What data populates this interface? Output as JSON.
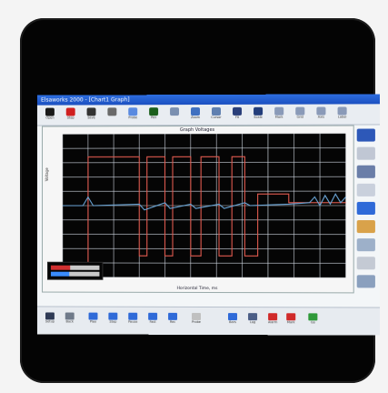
{
  "window": {
    "title": "Elsaworks 2000 - [Chart1 Graph]"
  },
  "toolbar": {
    "buttons": [
      {
        "label": "Open",
        "color": "#1a1a1a"
      },
      {
        "label": "Stop",
        "color": "#d02020"
      },
      {
        "label": "Save",
        "color": "#333333"
      },
      {
        "label": "",
        "color": "#6a6a6a"
      },
      {
        "label": "Probe",
        "color": "#5a8ae0"
      },
      {
        "label": "Pen",
        "color": "#1b5f1b"
      },
      {
        "label": "",
        "color": "#7a8fb0"
      },
      {
        "label": "Zoom",
        "color": "#4070c0"
      },
      {
        "label": "Cursor",
        "color": "#6080b0"
      },
      {
        "label": "Fit",
        "color": "#2a3f7a"
      },
      {
        "label": "Scale",
        "color": "#233d7a"
      },
      {
        "label": "Mark",
        "color": "#8a9ab8"
      },
      {
        "label": "Grid",
        "color": "#8a9ab8"
      },
      {
        "label": "Axis",
        "color": "#8a9ab8"
      },
      {
        "label": "Label",
        "color": "#8a9ab8"
      }
    ]
  },
  "chart_data": {
    "type": "line",
    "title": "Graph Voltages",
    "xlabel": "Horizontal Time, ms",
    "ylabel": "Voltage",
    "grid": true,
    "background": "#050505",
    "xlim": [
      0,
      11
    ],
    "ylim": [
      -5,
      5
    ],
    "series": [
      {
        "color": "#e05a4f",
        "x": [
          0,
          1.0,
          1.0,
          3.0,
          3.0,
          3.3,
          3.3,
          4.0,
          4.0,
          4.3,
          4.3,
          5.0,
          5.0,
          5.4,
          5.4,
          6.1,
          6.1,
          6.6,
          6.6,
          7.1,
          7.1,
          7.6,
          7.6,
          8.8,
          8.8,
          11
        ],
        "y": [
          -4.0,
          -4.0,
          3.4,
          3.4,
          -3.5,
          -3.5,
          3.4,
          3.4,
          -3.5,
          -3.5,
          3.4,
          3.4,
          -3.5,
          -3.5,
          3.4,
          3.4,
          -3.5,
          -3.5,
          3.4,
          3.4,
          -3.5,
          -3.5,
          0.8,
          0.8,
          0.2,
          0.2
        ]
      },
      {
        "color": "#6aa6d8",
        "x": [
          0,
          0.8,
          1.0,
          1.2,
          3.0,
          3.2,
          4.0,
          4.2,
          5.0,
          5.2,
          6.1,
          6.3,
          7.1,
          7.3,
          8.8,
          9.6,
          9.8,
          10.0,
          10.2,
          10.4,
          10.6,
          10.8,
          11
        ],
        "y": [
          0.0,
          0.0,
          0.6,
          0.0,
          0.1,
          -0.3,
          0.2,
          -0.2,
          0.1,
          -0.2,
          0.1,
          -0.2,
          0.2,
          0.0,
          0.1,
          0.2,
          0.6,
          0.0,
          0.7,
          0.1,
          0.8,
          0.2,
          0.6
        ]
      }
    ]
  },
  "side_panel": {
    "buttons": [
      {
        "color": "#2d58b8"
      },
      {
        "color": "#c0c7d4"
      },
      {
        "color": "#6a7ea8"
      },
      {
        "color": "#c9d0dc"
      },
      {
        "color": "#2f6ad8"
      },
      {
        "color": "#d9a24a"
      },
      {
        "color": "#9db0c9"
      },
      {
        "color": "#c4cad4"
      },
      {
        "color": "#8aa0be"
      }
    ]
  },
  "bottombar": {
    "buttons": [
      {
        "label": "Setup",
        "color": "#2e3a55"
      },
      {
        "label": "Back",
        "color": "#6f7a8a"
      },
      {
        "label": "Play",
        "color": "#2f6ad8"
      },
      {
        "label": "Step",
        "color": "#2f6ad8"
      },
      {
        "label": "Pause",
        "color": "#2f6ad8"
      },
      {
        "label": "Fast",
        "color": "#2f6ad8"
      },
      {
        "label": "Rec",
        "color": "#2f6ad8"
      },
      {
        "label": "Probe",
        "color": "#c0c0c0"
      },
      {
        "label": "Bars",
        "color": "#2f6ad8"
      },
      {
        "label": "Log",
        "color": "#4b5e86"
      },
      {
        "label": "Alarm",
        "color": "#d02a2a"
      },
      {
        "label": "Mark",
        "color": "#d02a2a"
      },
      {
        "label": "Go",
        "color": "#2f9a3a"
      }
    ]
  }
}
